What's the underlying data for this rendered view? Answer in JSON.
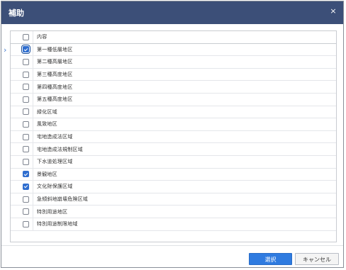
{
  "dialog": {
    "title": "補助",
    "close_label": "×"
  },
  "grid": {
    "header": {
      "label": "内容",
      "checked": false
    },
    "rows": [
      {
        "label": "第一種低層地区",
        "checked": true,
        "current": true
      },
      {
        "label": "第二種高層地区",
        "checked": false
      },
      {
        "label": "第三種高度地区",
        "checked": false
      },
      {
        "label": "第四種高度地区",
        "checked": false
      },
      {
        "label": "第五種高度地区",
        "checked": false
      },
      {
        "label": "緑化区域",
        "checked": false
      },
      {
        "label": "風致地区",
        "checked": false
      },
      {
        "label": "宅地造成法区域",
        "checked": false
      },
      {
        "label": "宅地造成法規制区域",
        "checked": false
      },
      {
        "label": "下水道処理区域",
        "checked": false
      },
      {
        "label": "景観地区",
        "checked": true
      },
      {
        "label": "文化財保護区域",
        "checked": true
      },
      {
        "label": "急傾斜地崩壊危険区域",
        "checked": false
      },
      {
        "label": "特別用途地区",
        "checked": false
      },
      {
        "label": "特別用途制限地域",
        "checked": false
      }
    ]
  },
  "buttons": {
    "select": "選択",
    "cancel": "キャンセル"
  },
  "colors": {
    "titlebar": "#3c4f78",
    "accent": "#2f7be0",
    "check": "#2f6ecf"
  }
}
